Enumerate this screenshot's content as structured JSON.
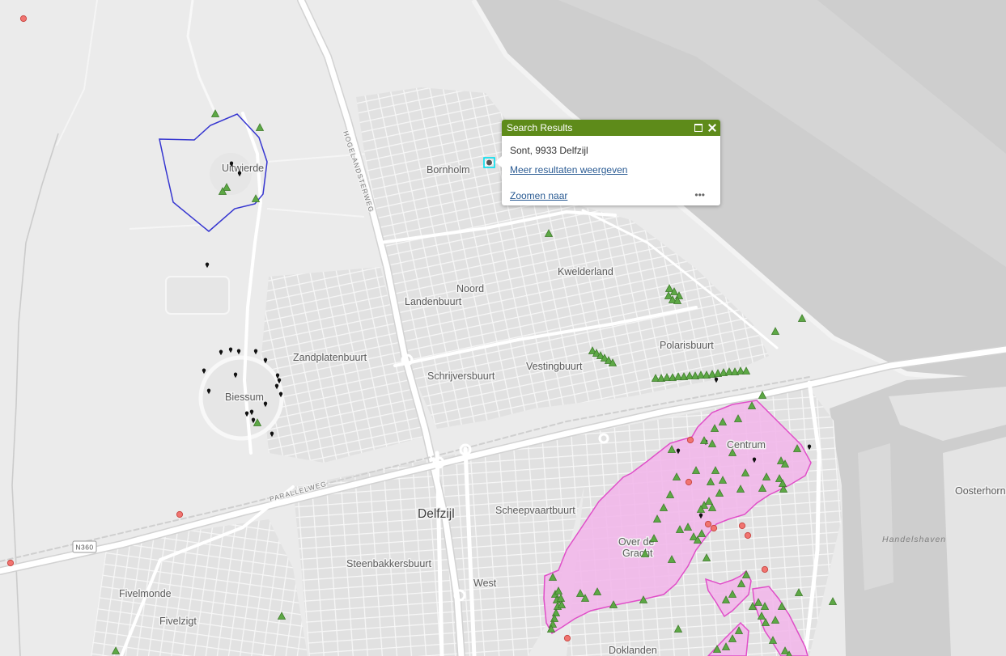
{
  "popup": {
    "title": "Search Results",
    "address": "Sont, 9933 Delfzijl",
    "more_results": "Meer resultaten weergeven",
    "zoom_to": "Zoomen naar",
    "more_options": "•••"
  },
  "map": {
    "labels": {
      "uitwierde": "Uitwierde",
      "bornholm": "Bornholm",
      "noord": "Noord",
      "landenbuurt": "Landenbuurt",
      "kwelderland": "Kwelderland",
      "polarisbuurt": "Polarisbuurt",
      "zandplatenbuurt": "Zandplatenbuurt",
      "schrijversbuurt": "Schrijversbuurt",
      "vestingbuurt": "Vestingbuurt",
      "biessum": "Biessum",
      "centrum": "Centrum",
      "delfzijl": "Delfzijl",
      "scheepvaartbuurt": "Scheepvaartbuurt",
      "over_de": "Over de",
      "gracht": "Gracht",
      "steenbakkersbuurt": "Steenbakkersbuurt",
      "west": "West",
      "fivelmonde": "Fivelmonde",
      "fivelzigt": "Fivelzigt",
      "doklanden": "Doklanden",
      "handelshaven": "Handelshaven",
      "oosterhorn": "Oosterhorn",
      "hogelandsterweg": "HOGELANDSTERWEG",
      "parallelweg": "PARALLELWEG",
      "n360": "N360"
    }
  },
  "icons": {
    "maximize": "maximize-icon",
    "close": "close-icon",
    "more": "more-options-icon",
    "tree_marker": "triangle-marker-icon",
    "incident_marker": "circle-marker-icon",
    "pin_marker": "pin-marker-icon"
  },
  "colors": {
    "popup_header": "#5e8b1a",
    "link": "#2a5b93",
    "tree_marker": "#5da845",
    "tree_marker_stroke": "#3d7a2a",
    "incident_marker": "#f17470",
    "incident_marker_stroke": "#c94a46",
    "pin_marker": "#111111",
    "area_fill": "#f2b8ea",
    "area_stroke": "#e04fc8",
    "boundary_stroke": "#3535d0",
    "selection": "#00e0f0"
  }
}
